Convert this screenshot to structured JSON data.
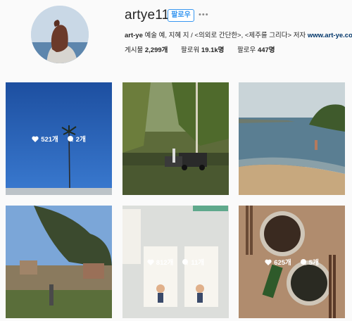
{
  "profile": {
    "username": "artye11",
    "follow_label": "팔로우",
    "more_label": "•••",
    "bio_name": "art-ye",
    "bio_text": " 예술 예, 지혜 지 / <의외로 간단한>, <제주를 그리다> 저자 ",
    "bio_link": "www.art-ye.com",
    "stats": {
      "posts_label": "게시물",
      "posts_value": "2,299개",
      "followers_label": "팔로워",
      "followers_value": "19.1k명",
      "following_label": "팔로우",
      "following_value": "447명"
    }
  },
  "posts": [
    {
      "likes": "521개",
      "comments": "2개",
      "show_counts": true
    },
    {
      "likes": "",
      "comments": "",
      "show_counts": false
    },
    {
      "likes": "",
      "comments": "",
      "show_counts": false
    },
    {
      "likes": "",
      "comments": "",
      "show_counts": false
    },
    {
      "likes": "812개",
      "comments": "11개",
      "show_counts": true
    },
    {
      "likes": "625개",
      "comments": "5개",
      "show_counts": true
    }
  ],
  "icons": {
    "like": "heart-icon",
    "comment": "comment-icon",
    "more": "more-dots-icon"
  },
  "colors": {
    "accent": "#3897f0",
    "link": "#003569"
  }
}
